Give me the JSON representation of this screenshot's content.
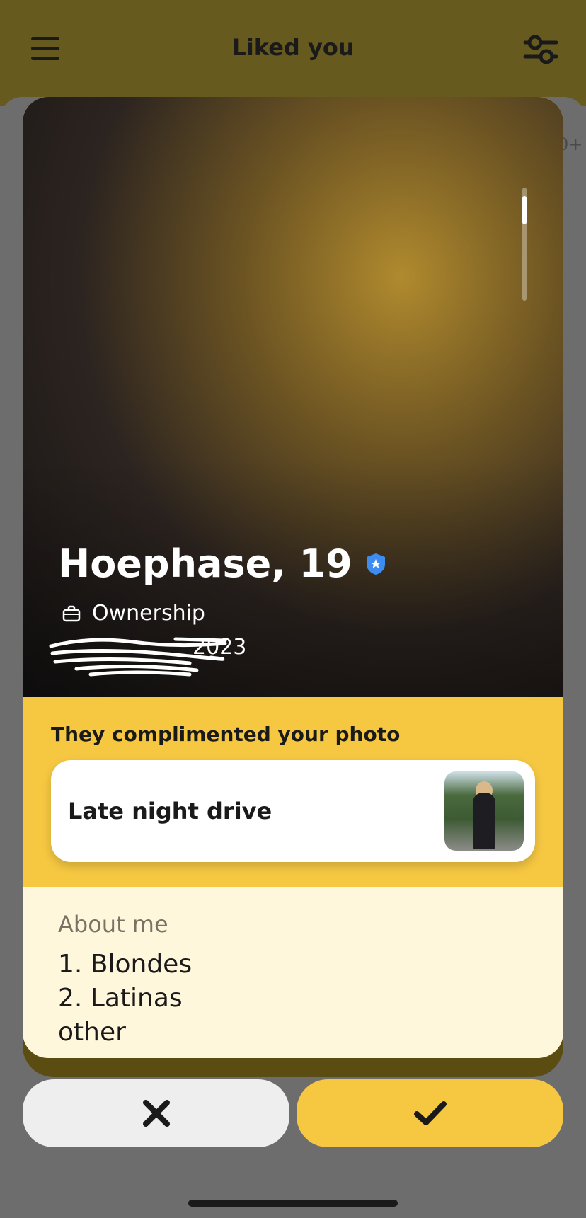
{
  "header": {
    "title": "Liked you",
    "menu_icon": "hamburger-icon",
    "filter_icon": "filter-sliders-icon"
  },
  "peek_count": "0+",
  "profile": {
    "name_age": "Hoephase, 19",
    "verified_icon": "verified-shield-icon",
    "job_icon": "briefcase-icon",
    "job": "Ownership",
    "since": "2023"
  },
  "compliment": {
    "title": "They complimented your photo",
    "text": "Late night drive"
  },
  "about": {
    "title": "About me",
    "lines": [
      "1. Blondes",
      "2. Latinas",
      "other"
    ]
  },
  "actions": {
    "pass_icon": "close-x-icon",
    "like_icon": "checkmark-icon"
  },
  "colors": {
    "accent": "#f6c842",
    "header_bg": "#665a1f",
    "about_bg": "#fff7dc"
  }
}
